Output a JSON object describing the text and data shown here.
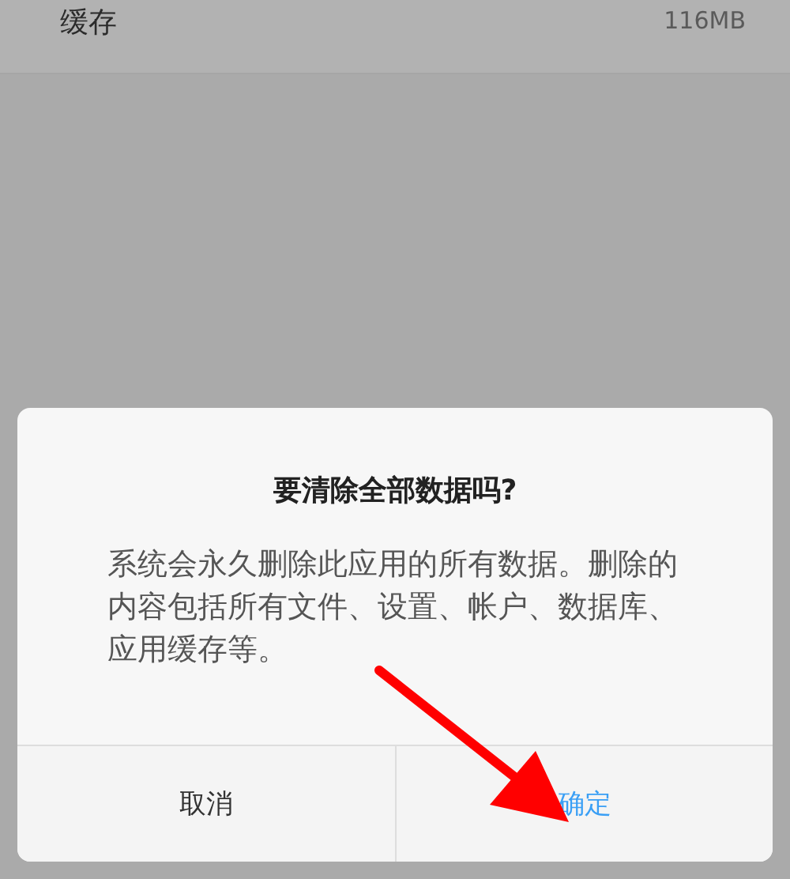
{
  "settings_row": {
    "label": "缓存",
    "value": "116MB"
  },
  "dialog": {
    "title": "要清除全部数据吗?",
    "message": "系统会永久删除此应用的所有数据。删除的内容包括所有文件、设置、帐户、数据库、应用缓存等。",
    "buttons": [
      {
        "label": "取消",
        "kind": "cancel"
      },
      {
        "label": "确定",
        "kind": "confirm"
      }
    ]
  }
}
